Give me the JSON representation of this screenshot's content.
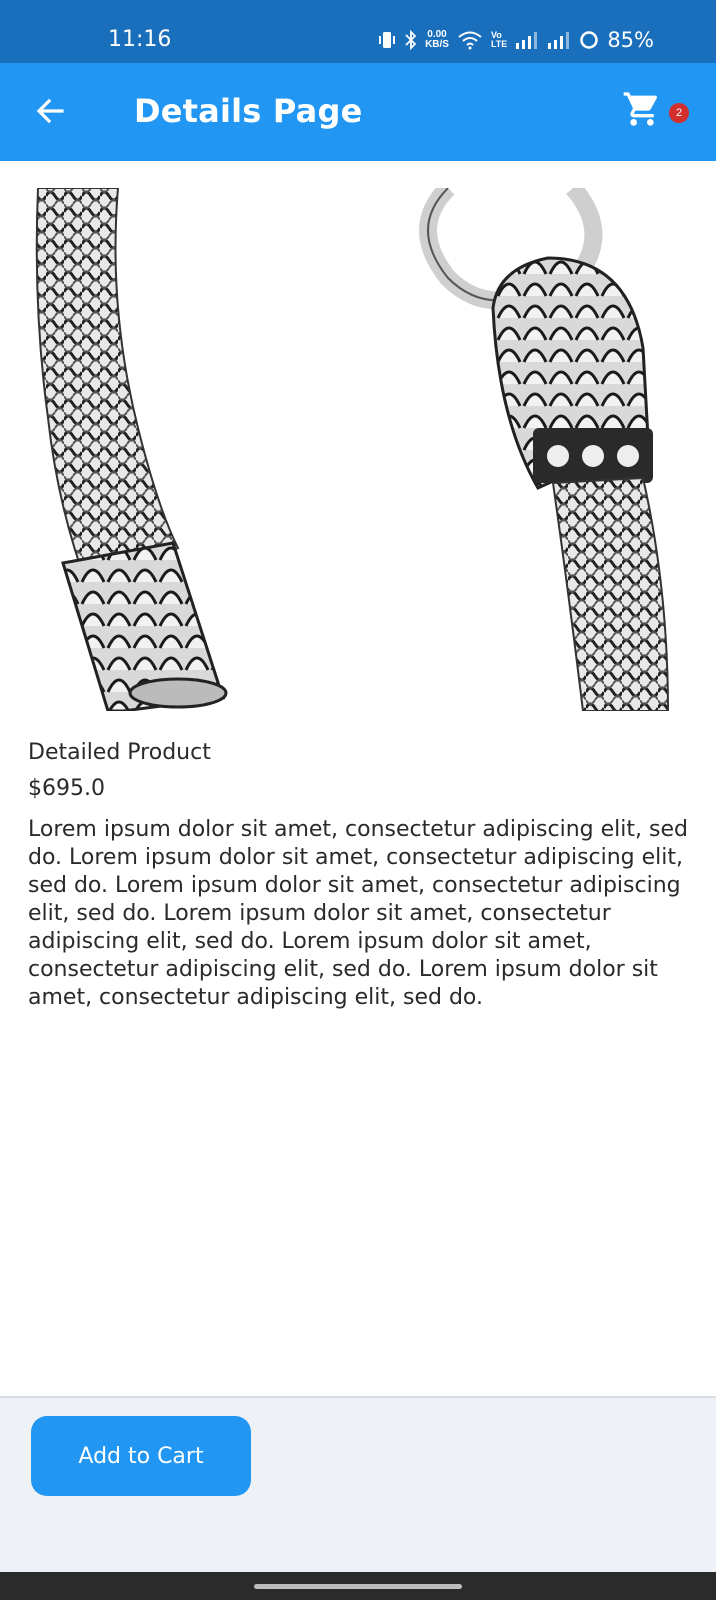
{
  "status_bar": {
    "time": "11:16",
    "net_speed_value": "0.00",
    "net_speed_unit": "KB/S",
    "volte_top": "Vo",
    "volte_bottom": "LTE",
    "battery": "85%"
  },
  "app_bar": {
    "title": "Details Page",
    "cart_count": "2",
    "color": "#2196f3"
  },
  "product": {
    "name": "Detailed Product",
    "price": "$695.0",
    "description": "Lorem ipsum dolor sit amet, consectetur adipiscing elit, sed do. Lorem ipsum dolor sit amet, consectetur adipiscing elit, sed do. Lorem ipsum dolor sit amet, consectetur adipiscing elit, sed do. Lorem ipsum dolor sit amet, consectetur adipiscing elit, sed do. Lorem ipsum dolor sit amet, consectetur adipiscing elit, sed do. Lorem ipsum dolor sit amet, consectetur adipiscing elit, sed do."
  },
  "bottom_bar": {
    "add_to_cart_label": "Add to Cart"
  },
  "icons": {
    "back": "arrow-back-icon",
    "cart": "shopping-cart-icon",
    "image": "silver-chain-bracelet"
  }
}
